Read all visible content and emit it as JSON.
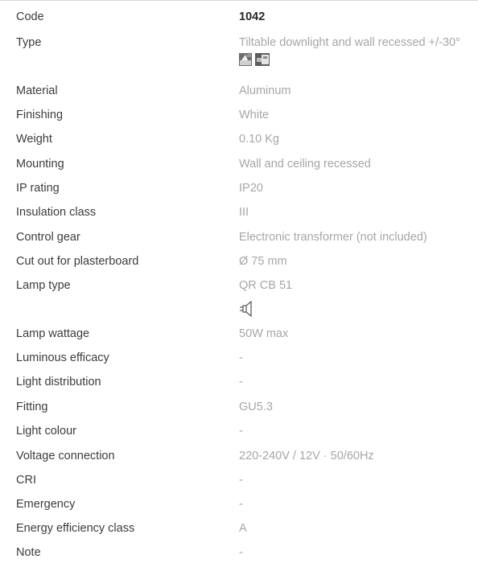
{
  "specs": [
    {
      "label": "Code",
      "value": "1042"
    },
    {
      "label": "Type",
      "value": "Tiltable downlight and wall recessed +/-30°"
    },
    {
      "label": "Material",
      "value": "Aluminum"
    },
    {
      "label": "Finishing",
      "value": "White"
    },
    {
      "label": "Weight",
      "value": "0.10 Kg"
    },
    {
      "label": "Mounting",
      "value": "Wall and ceiling recessed"
    },
    {
      "label": "IP rating",
      "value": "IP20"
    },
    {
      "label": "Insulation class",
      "value": "III"
    },
    {
      "label": "Control gear",
      "value": "Electronic transformer (not included)"
    },
    {
      "label": "Cut out for plasterboard",
      "value": "Ø 75 mm"
    },
    {
      "label": "Lamp type",
      "value": "QR CB 51"
    },
    {
      "label": "Lamp wattage",
      "value": "50W max"
    },
    {
      "label": "Luminous efficacy",
      "value": "-"
    },
    {
      "label": "Light distribution",
      "value": "-"
    },
    {
      "label": "Fitting",
      "value": "GU5.3"
    },
    {
      "label": "Light colour",
      "value": "-"
    },
    {
      "label": "Voltage connection",
      "value": "220-240V / 12V · 50/60Hz"
    },
    {
      "label": "CRI",
      "value": "-"
    },
    {
      "label": "Emergency",
      "value": "-"
    },
    {
      "label": "Energy efficiency class",
      "value": "A"
    },
    {
      "label": "Note",
      "value": "-"
    }
  ],
  "icons": {
    "type_icons": [
      "downlight-tilt-icon",
      "wall-recessed-icon"
    ],
    "lamp_icon": "halogen-lamp-icon"
  },
  "colors": {
    "label": "#3c3c3c",
    "value": "#a6a6a6",
    "code_value": "#2a2a2a",
    "rule": "#d9d9d9"
  }
}
